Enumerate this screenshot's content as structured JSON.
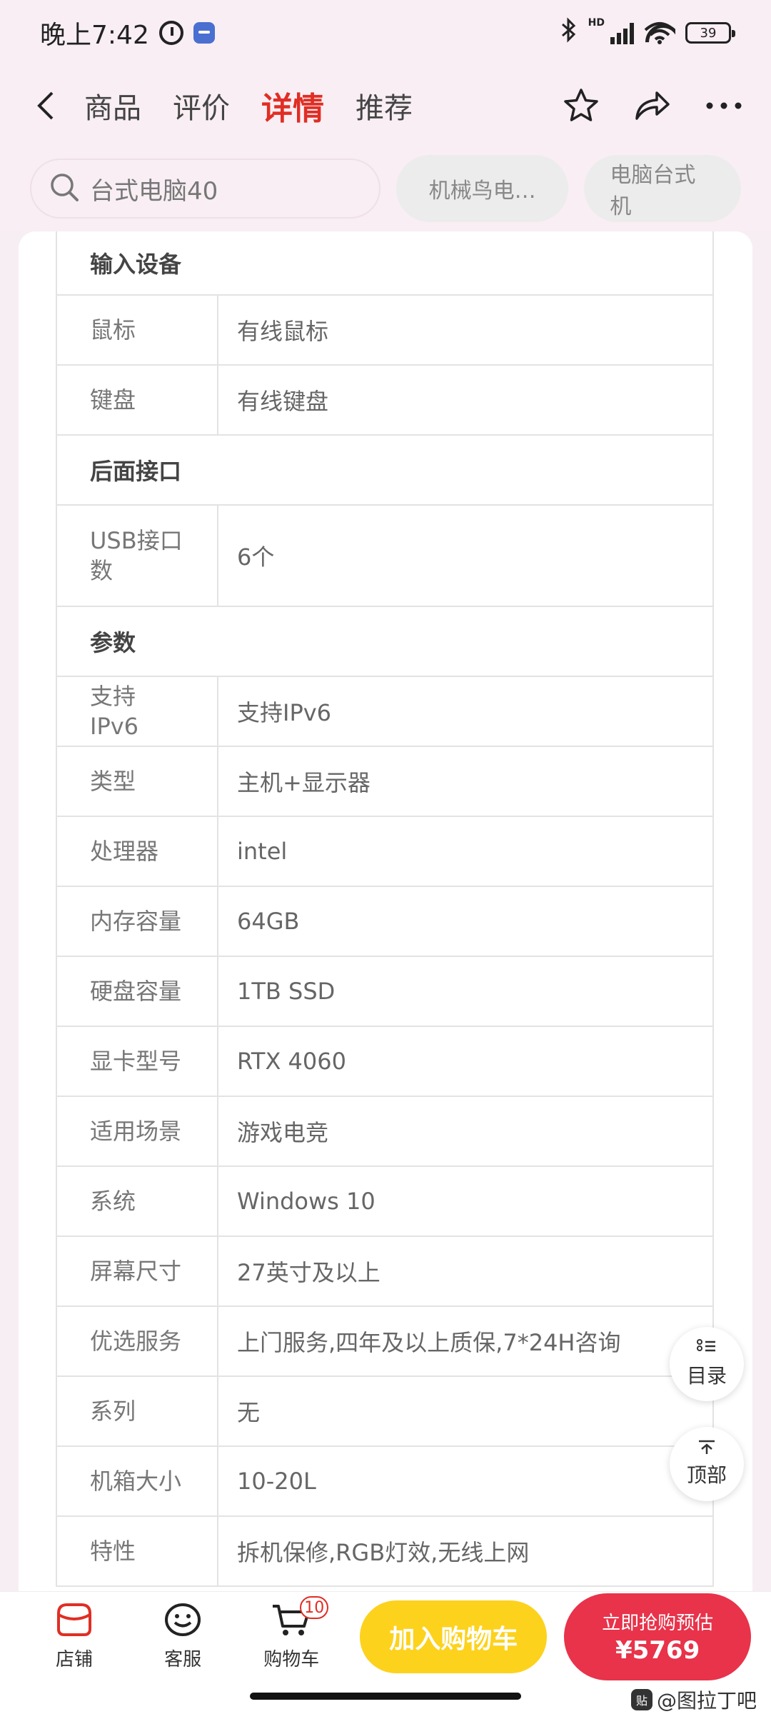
{
  "status_bar": {
    "time": "晚上7:42",
    "battery": "39",
    "network_label": "HD"
  },
  "nav": {
    "tabs": [
      {
        "label": "商品",
        "active": false
      },
      {
        "label": "评价",
        "active": false
      },
      {
        "label": "详情",
        "active": true
      },
      {
        "label": "推荐",
        "active": false
      }
    ]
  },
  "search": {
    "placeholder": "台式电脑40",
    "chips": [
      "机械鸟电…",
      "电脑台式机"
    ]
  },
  "specs": {
    "input_section": "输入设备",
    "mouse_key": "鼠标",
    "mouse_val": "有线鼠标",
    "keyboard_key": "键盘",
    "keyboard_val": "有线键盘",
    "rear_section": "后面接口",
    "usb_key": "USB接口数",
    "usb_val": "6个",
    "params_section": "参数",
    "rows": [
      {
        "key": "支持IPv6",
        "val": "支持IPv6"
      },
      {
        "key": "类型",
        "val": "主机+显示器"
      },
      {
        "key": "处理器",
        "val": "intel"
      },
      {
        "key": "内存容量",
        "val": "64GB"
      },
      {
        "key": "硬盘容量",
        "val": "1TB SSD"
      },
      {
        "key": "显卡型号",
        "val": "RTX 4060"
      },
      {
        "key": "适用场景",
        "val": "游戏电竞"
      },
      {
        "key": "系统",
        "val": "Windows 10"
      },
      {
        "key": "屏幕尺寸",
        "val": "27英寸及以上"
      },
      {
        "key": "优选服务",
        "val": "上门服务,四年及以上质保,7*24H咨询"
      },
      {
        "key": "系列",
        "val": "无"
      },
      {
        "key": "机箱大小",
        "val": "10-20L"
      },
      {
        "key": "特性",
        "val": "拆机保修,RGB灯效,无线上网"
      }
    ]
  },
  "floating": {
    "toc_label": "目录",
    "top_label": "顶部"
  },
  "bottom_bar": {
    "store_label": "店铺",
    "service_label": "客服",
    "cart_label": "购物车",
    "cart_count": "10",
    "add_to_cart": "加入购物车",
    "buy_label": "立即抢购预估",
    "buy_price": "¥5769"
  },
  "watermark": {
    "text": "@图拉丁吧",
    "logo": "贴"
  },
  "colors": {
    "accent": "#e02e24",
    "add_cart": "#fcd21d",
    "buy": "#e8334a"
  }
}
